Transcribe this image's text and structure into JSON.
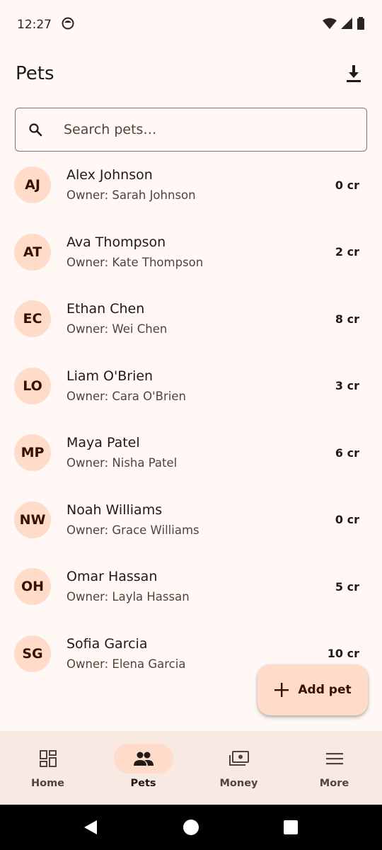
{
  "status_bar": {
    "time": "12:27"
  },
  "app_bar": {
    "title": "Pets"
  },
  "search": {
    "placeholder": "Search pets…",
    "value": ""
  },
  "pets": [
    {
      "initials": "AJ",
      "name": "Alex Johnson",
      "owner": "Owner: Sarah Johnson",
      "credits": "0 cr"
    },
    {
      "initials": "AT",
      "name": "Ava Thompson",
      "owner": "Owner: Kate Thompson",
      "credits": "2 cr"
    },
    {
      "initials": "EC",
      "name": "Ethan Chen",
      "owner": "Owner: Wei Chen",
      "credits": "8 cr"
    },
    {
      "initials": "LO",
      "name": "Liam O'Brien",
      "owner": "Owner: Cara O'Brien",
      "credits": "3 cr"
    },
    {
      "initials": "MP",
      "name": "Maya Patel",
      "owner": "Owner: Nisha Patel",
      "credits": "6 cr"
    },
    {
      "initials": "NW",
      "name": "Noah Williams",
      "owner": "Owner: Grace Williams",
      "credits": "0 cr"
    },
    {
      "initials": "OH",
      "name": "Omar Hassan",
      "owner": "Owner: Layla Hassan",
      "credits": "5 cr"
    },
    {
      "initials": "SG",
      "name": "Sofia Garcia",
      "owner": "Owner: Elena Garcia",
      "credits": "10 cr"
    }
  ],
  "fab": {
    "label": "Add pet",
    "icon": "plus-icon"
  },
  "bottom_nav": {
    "items": [
      {
        "label": "Home",
        "icon": "dashboard-icon",
        "active": false
      },
      {
        "label": "Pets",
        "icon": "people-icon",
        "active": true
      },
      {
        "label": "Money",
        "icon": "payments-icon",
        "active": false
      },
      {
        "label": "More",
        "icon": "menu-icon",
        "active": false
      }
    ]
  },
  "colors": {
    "background": "#FFF8F4",
    "accent_container": "#FFDBCA",
    "on_accent_container": "#341100",
    "nav_background": "#F8E9E2"
  }
}
